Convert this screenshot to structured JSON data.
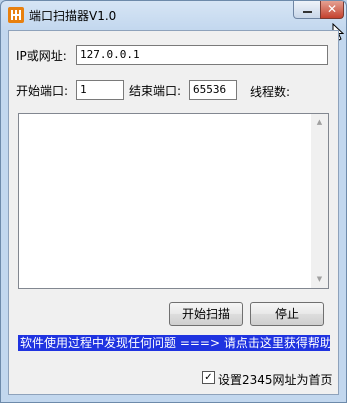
{
  "window": {
    "title": "端口扫描器V1.0",
    "close_glyph": "✕"
  },
  "form": {
    "ip_label": "IP或网址:",
    "ip_value": "127.0.0.1",
    "start_port_label": "开始端口:",
    "start_port_value": "1",
    "end_port_label": "结束端口:",
    "end_port_value": "65536",
    "threads_label": "线程数:"
  },
  "log": {
    "content": "",
    "scroll_up": "▲",
    "scroll_down": "▼"
  },
  "buttons": {
    "start_scan": "开始扫描",
    "stop": "停止"
  },
  "banner": {
    "text": "软件使用过程中发现任何问题 ===> 请点击这里获得帮助",
    "background": "#1f33e0"
  },
  "homepage": {
    "checked": true,
    "check_glyph": "✓",
    "label": "设置2345网址为首页"
  },
  "icons": [
    "app-icon",
    "minimize-icon",
    "close-icon",
    "mouse-cursor-icon"
  ]
}
